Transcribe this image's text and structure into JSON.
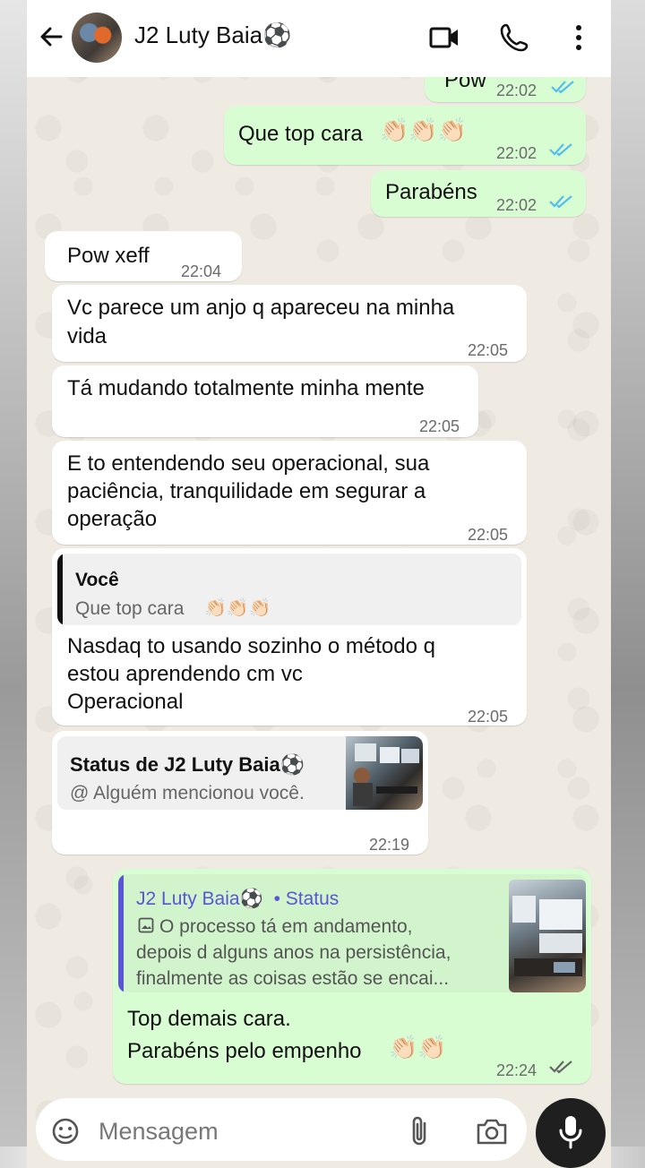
{
  "header": {
    "contact_name": "J2 Luty Baia⚽"
  },
  "messages": {
    "m0": {
      "text": "Pow",
      "time": "22:02"
    },
    "m1": {
      "text": "Que top cara",
      "emoji": "👏🏻👏🏻👏🏻",
      "time": "22:02"
    },
    "m2": {
      "text": "Parabéns",
      "time": "22:02"
    },
    "m3": {
      "text": "Pow xeff",
      "time": "22:04"
    },
    "m4": {
      "line1": "Vc parece um anjo q apareceu na minha",
      "line2": "vida",
      "time": "22:05"
    },
    "m5": {
      "text": "Tá mudando totalmente minha mente",
      "time": "22:05"
    },
    "m6": {
      "line1": "E to entendendo seu operacional, sua",
      "line2": "paciência, tranquilidade em segurar a",
      "line3": "operação",
      "time": "22:05"
    },
    "m7": {
      "quote_author": "Você",
      "quote_text": "Que top cara",
      "quote_emoji": "👏🏻👏🏻👏🏻",
      "line1": "Nasdaq to usando sozinho o método q",
      "line2": "estou aprendendo cm vc",
      "line3": "Operacional",
      "time": "22:05"
    },
    "m8": {
      "status_title": "Status de J2 Luty Baia⚽",
      "status_sub": "@ Alguém mencionou você.",
      "time": "22:19"
    },
    "m9": {
      "quote_author": "J2 Luty Baia⚽",
      "quote_tag": "• Status",
      "quote_line1": "O processo tá em andamento,",
      "quote_line2": "depois d alguns anos na persistência,",
      "quote_line3": "finalmente as coisas estão se encai...",
      "line1": "Top demais cara.",
      "line2": "Parabéns pelo empenho",
      "emoji": "👏🏻👏🏻",
      "time": "22:24"
    }
  },
  "composer": {
    "placeholder": "Mensagem"
  },
  "colors": {
    "outgoing": "#d9fdd3",
    "incoming": "#ffffff",
    "read_ticks": "#53bdeb",
    "quote_bar_in": "#111111",
    "quote_bar_status": "#5b55d4"
  }
}
